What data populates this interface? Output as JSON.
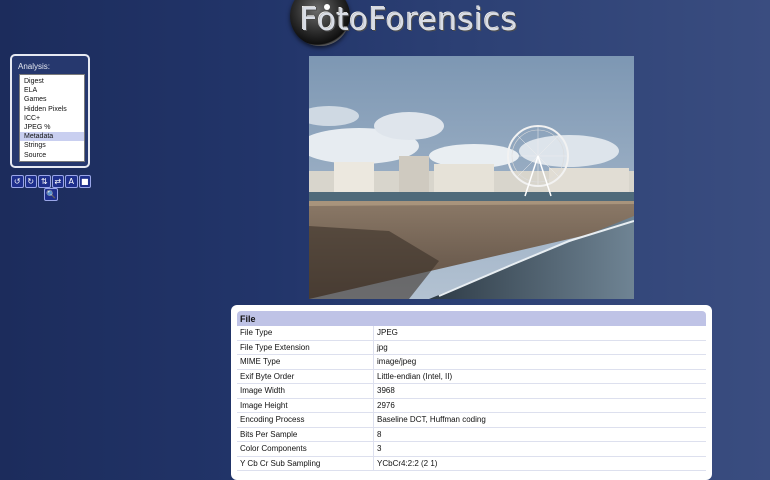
{
  "logo": {
    "text": "FotoForensics"
  },
  "analysis": {
    "label": "Analysis:",
    "items": [
      {
        "label": "Digest",
        "selected": false
      },
      {
        "label": "ELA",
        "selected": false
      },
      {
        "label": "Games",
        "selected": false
      },
      {
        "label": "Hidden Pixels",
        "selected": false
      },
      {
        "label": "ICC+",
        "selected": false
      },
      {
        "label": "JPEG %",
        "selected": false
      },
      {
        "label": "Metadata",
        "selected": true
      },
      {
        "label": "Strings",
        "selected": false
      },
      {
        "label": "Source",
        "selected": false
      }
    ]
  },
  "toolbar": {
    "buttons": [
      {
        "name": "rotate-left-icon",
        "glyph": "↺"
      },
      {
        "name": "rotate-right-icon",
        "glyph": "↻"
      },
      {
        "name": "flip-vertical-icon",
        "glyph": "⇅"
      },
      {
        "name": "flip-horizontal-icon",
        "glyph": "⇄"
      },
      {
        "name": "text-icon",
        "glyph": "A"
      },
      {
        "name": "stop-icon",
        "glyph": "■"
      }
    ],
    "zoom": {
      "name": "zoom-icon",
      "glyph": "🔍"
    }
  },
  "photo": {
    "alt": ""
  },
  "metadata": {
    "section": "File",
    "rows": [
      {
        "key": "File Type",
        "value": "JPEG"
      },
      {
        "key": "File Type Extension",
        "value": "jpg"
      },
      {
        "key": "MIME Type",
        "value": "image/jpeg"
      },
      {
        "key": "Exif Byte Order",
        "value": "Little-endian (Intel, II)"
      },
      {
        "key": "Image Width",
        "value": "3968"
      },
      {
        "key": "Image Height",
        "value": "2976"
      },
      {
        "key": "Encoding Process",
        "value": "Baseline DCT, Huffman coding"
      },
      {
        "key": "Bits Per Sample",
        "value": "8"
      },
      {
        "key": "Color Components",
        "value": "3"
      },
      {
        "key": "Y Cb Cr Sub Sampling",
        "value": "YCbCr4:2:2 (2 1)"
      }
    ]
  }
}
